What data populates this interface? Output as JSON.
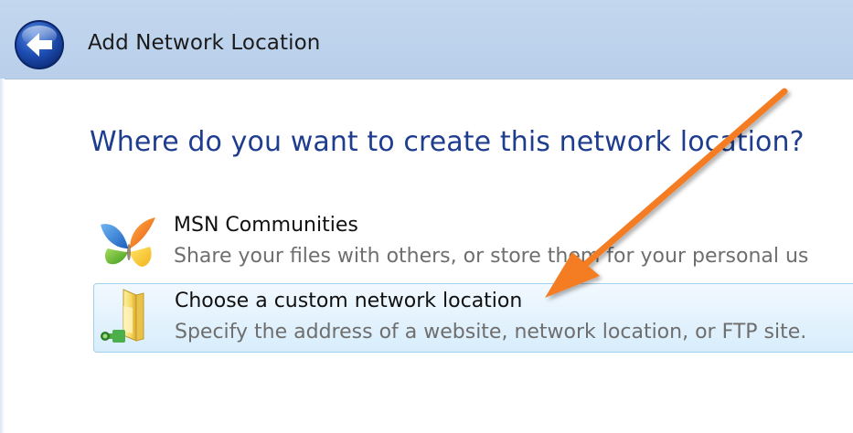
{
  "window": {
    "title": "Add Network Location"
  },
  "icons": {
    "back": "back-arrow-icon",
    "msn": "msn-butterfly-icon",
    "folder": "network-folder-icon",
    "annotation": "orange-arrow-annotation"
  },
  "colors": {
    "heading": "#1e3d8f",
    "titlebar": "#c3d7ee",
    "selected_bg": "#e3f2fd",
    "selected_border": "#9fd0ee",
    "annotation_arrow": "#f47b20"
  },
  "main": {
    "heading": "Where do you want to create this network location?",
    "options": [
      {
        "title": "MSN Communities",
        "description": "Share your files with others, or store them for your personal us",
        "selected": false
      },
      {
        "title": "Choose a custom network location",
        "description": "Specify the address of a website, network location, or FTP site.",
        "selected": true
      }
    ]
  }
}
